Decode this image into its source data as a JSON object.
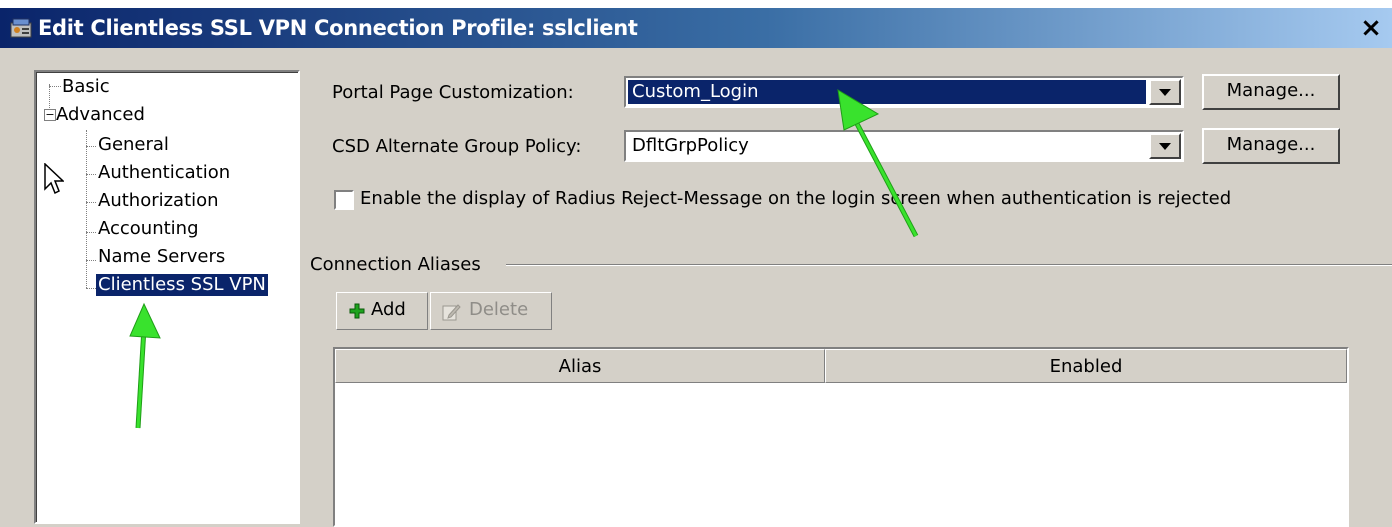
{
  "window": {
    "title": "Edit Clientless SSL VPN Connection Profile: sslclient",
    "close_label": "×"
  },
  "tree": {
    "items": [
      {
        "label": "Basic"
      },
      {
        "label": "Advanced"
      },
      {
        "label": "General"
      },
      {
        "label": "Authentication"
      },
      {
        "label": "Authorization"
      },
      {
        "label": "Accounting"
      },
      {
        "label": "Name Servers"
      },
      {
        "label": "Clientless SSL VPN"
      }
    ],
    "expander_symbol": "−",
    "selected": "Clientless SSL VPN"
  },
  "form": {
    "portal_label": "Portal Page Customization:",
    "portal_value": "Custom_Login",
    "manage_label": "Manage...",
    "csd_label": "CSD Alternate Group Policy:",
    "csd_value": "DfltGrpPolicy",
    "checkbox_label": "Enable the display of Radius Reject-Message on the login screen when authentication is rejected",
    "checkbox_checked": false
  },
  "aliases": {
    "group_label": "Connection Aliases",
    "add_label": "Add",
    "delete_label": "Delete",
    "columns": [
      "Alias",
      "Enabled"
    ],
    "rows": []
  },
  "icons": {
    "title": "profile-icon",
    "add": "add-icon",
    "delete": "delete-icon"
  },
  "colors": {
    "title_start": "#0a246a",
    "title_end": "#a6caf0",
    "selection": "#0a246a",
    "annotation_arrow": "#39e22d"
  }
}
